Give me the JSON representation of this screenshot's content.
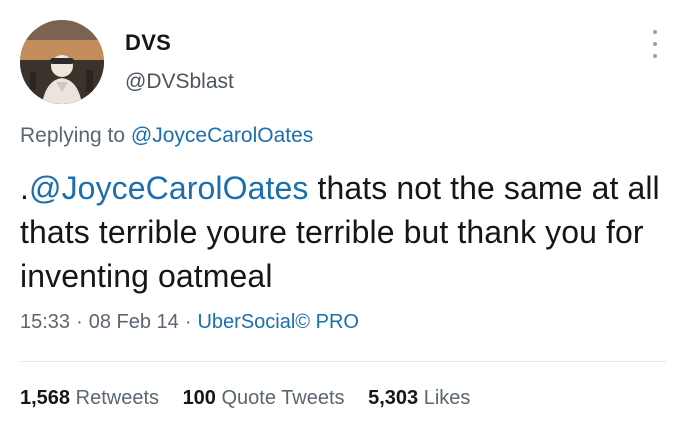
{
  "author": {
    "display_name": "DVS",
    "handle": "@DVSblast",
    "avatar_icon": "profile-photo"
  },
  "reply": {
    "prefix": "Replying to",
    "mention": "@JoyceCarolOates"
  },
  "tweet": {
    "lead": ".",
    "mention": "@JoyceCarolOates",
    "text": " thats not the same at all thats terrible youre terrible but thank you for inventing oatmeal"
  },
  "meta": {
    "time": "15:33",
    "date": "08 Feb 14",
    "source": "UberSocial© PRO",
    "separator": "·"
  },
  "stats": {
    "retweets": {
      "count": "1,568",
      "label": "Retweets"
    },
    "quote_tweets": {
      "count": "100",
      "label": "Quote Tweets"
    },
    "likes": {
      "count": "5,303",
      "label": "Likes"
    }
  },
  "colors": {
    "link": "#1b6fb0",
    "secondary_text": "#5b6670",
    "primary_text": "#14171a"
  }
}
